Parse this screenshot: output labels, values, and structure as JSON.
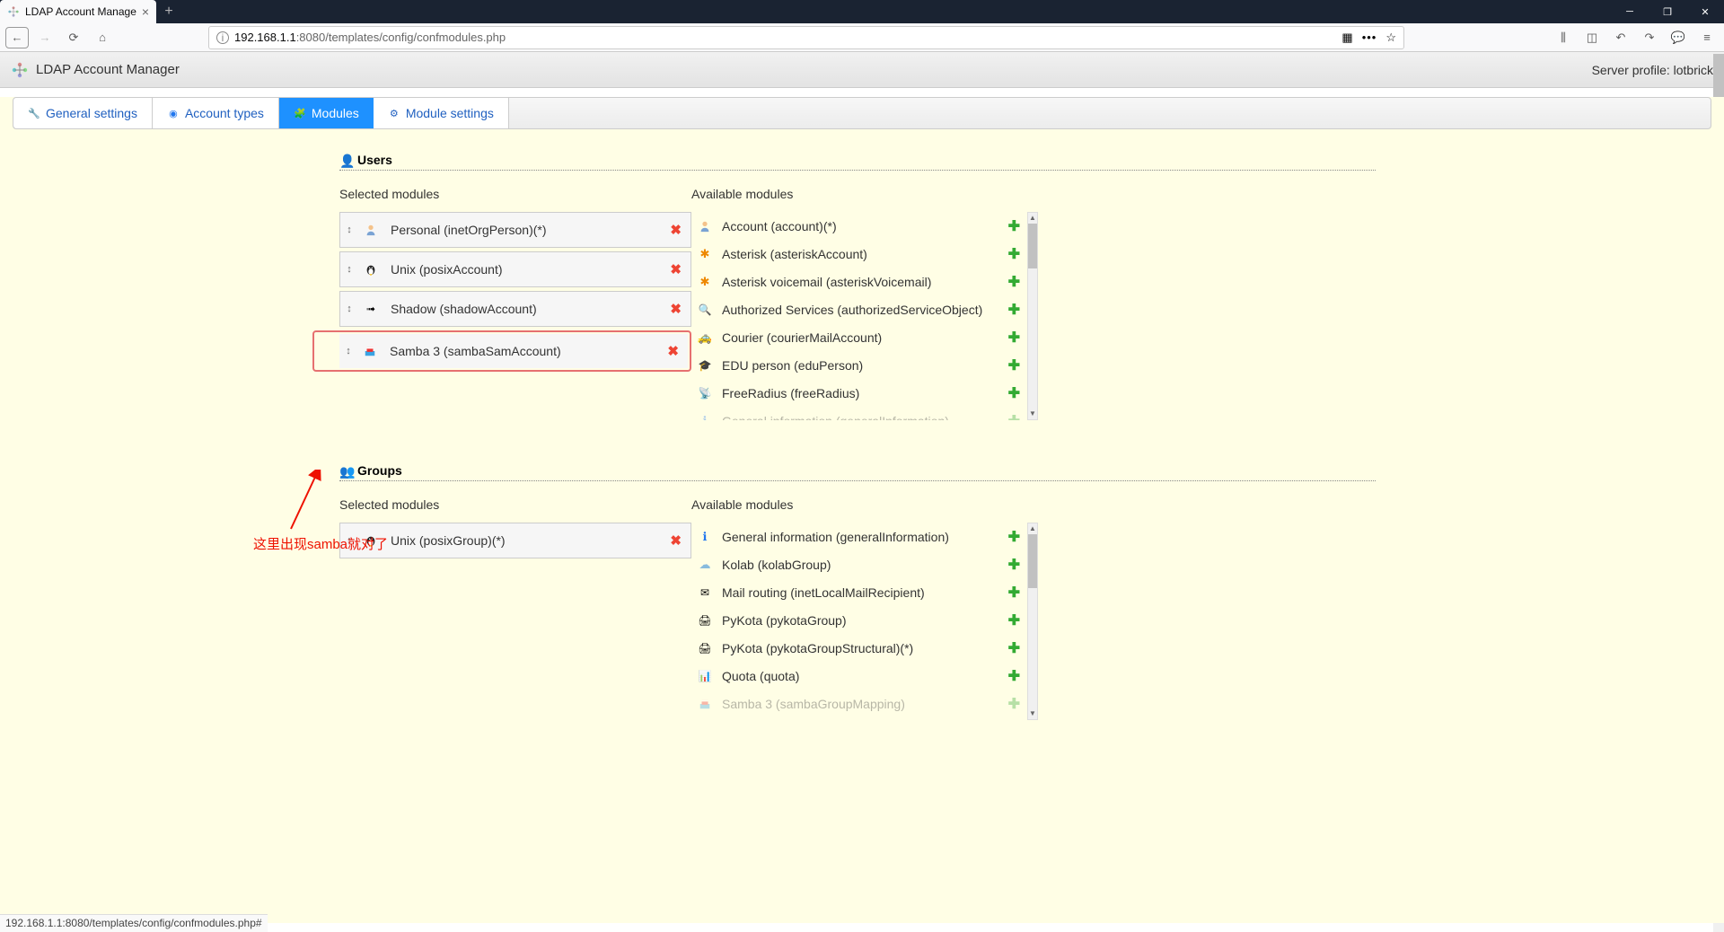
{
  "browser": {
    "tab_title": "LDAP Account Manager Con",
    "url_prefix": "192.168.1.1",
    "url_rest": ":8080/templates/config/confmodules.php"
  },
  "app": {
    "title": "LDAP Account Manager",
    "server_profile_label": "Server profile: ",
    "server_profile": "lotbrick"
  },
  "tabs": [
    {
      "label": "General settings"
    },
    {
      "label": "Account types"
    },
    {
      "label": "Modules",
      "active": true
    },
    {
      "label": "Module settings"
    }
  ],
  "sections": {
    "users": {
      "title": "Users",
      "selected_header": "Selected modules",
      "available_header": "Available modules",
      "selected": [
        {
          "label": "Personal (inetOrgPerson)(*)",
          "icon": "person"
        },
        {
          "label": "Unix (posixAccount)",
          "icon": "tux"
        },
        {
          "label": "Shadow (shadowAccount)",
          "icon": "shadow"
        },
        {
          "label": "Samba 3 (sambaSamAccount)",
          "icon": "samba",
          "highlighted": true
        }
      ],
      "available": [
        {
          "label": "Account (account)(*)",
          "icon": "person"
        },
        {
          "label": "Asterisk (asteriskAccount)",
          "icon": "ast"
        },
        {
          "label": "Asterisk voicemail (asteriskVoicemail)",
          "icon": "ast"
        },
        {
          "label": "Authorized Services (authorizedServiceObject)",
          "icon": "search"
        },
        {
          "label": "Courier (courierMailAccount)",
          "icon": "car"
        },
        {
          "label": "EDU person (eduPerson)",
          "icon": "edu"
        },
        {
          "label": "FreeRadius (freeRadius)",
          "icon": "radio"
        },
        {
          "label": "General information (generalInformation)",
          "icon": "info",
          "cut": true
        }
      ]
    },
    "groups": {
      "title": "Groups",
      "selected_header": "Selected modules",
      "available_header": "Available modules",
      "selected": [
        {
          "label": "Unix (posixGroup)(*)",
          "icon": "tux"
        }
      ],
      "available": [
        {
          "label": "General information (generalInformation)",
          "icon": "info"
        },
        {
          "label": "Kolab (kolabGroup)",
          "icon": "kolab"
        },
        {
          "label": "Mail routing (inetLocalMailRecipient)",
          "icon": "mail"
        },
        {
          "label": "PyKota (pykotaGroup)",
          "icon": "printer"
        },
        {
          "label": "PyKota (pykotaGroupStructural)(*)",
          "icon": "printer"
        },
        {
          "label": "Quota (quota)",
          "icon": "quota"
        },
        {
          "label": "Samba 3 (sambaGroupMapping)",
          "icon": "samba",
          "cut": true
        }
      ]
    }
  },
  "annotation": "这里出现samba就对了",
  "status_bar": "192.168.1.1:8080/templates/config/confmodules.php#"
}
